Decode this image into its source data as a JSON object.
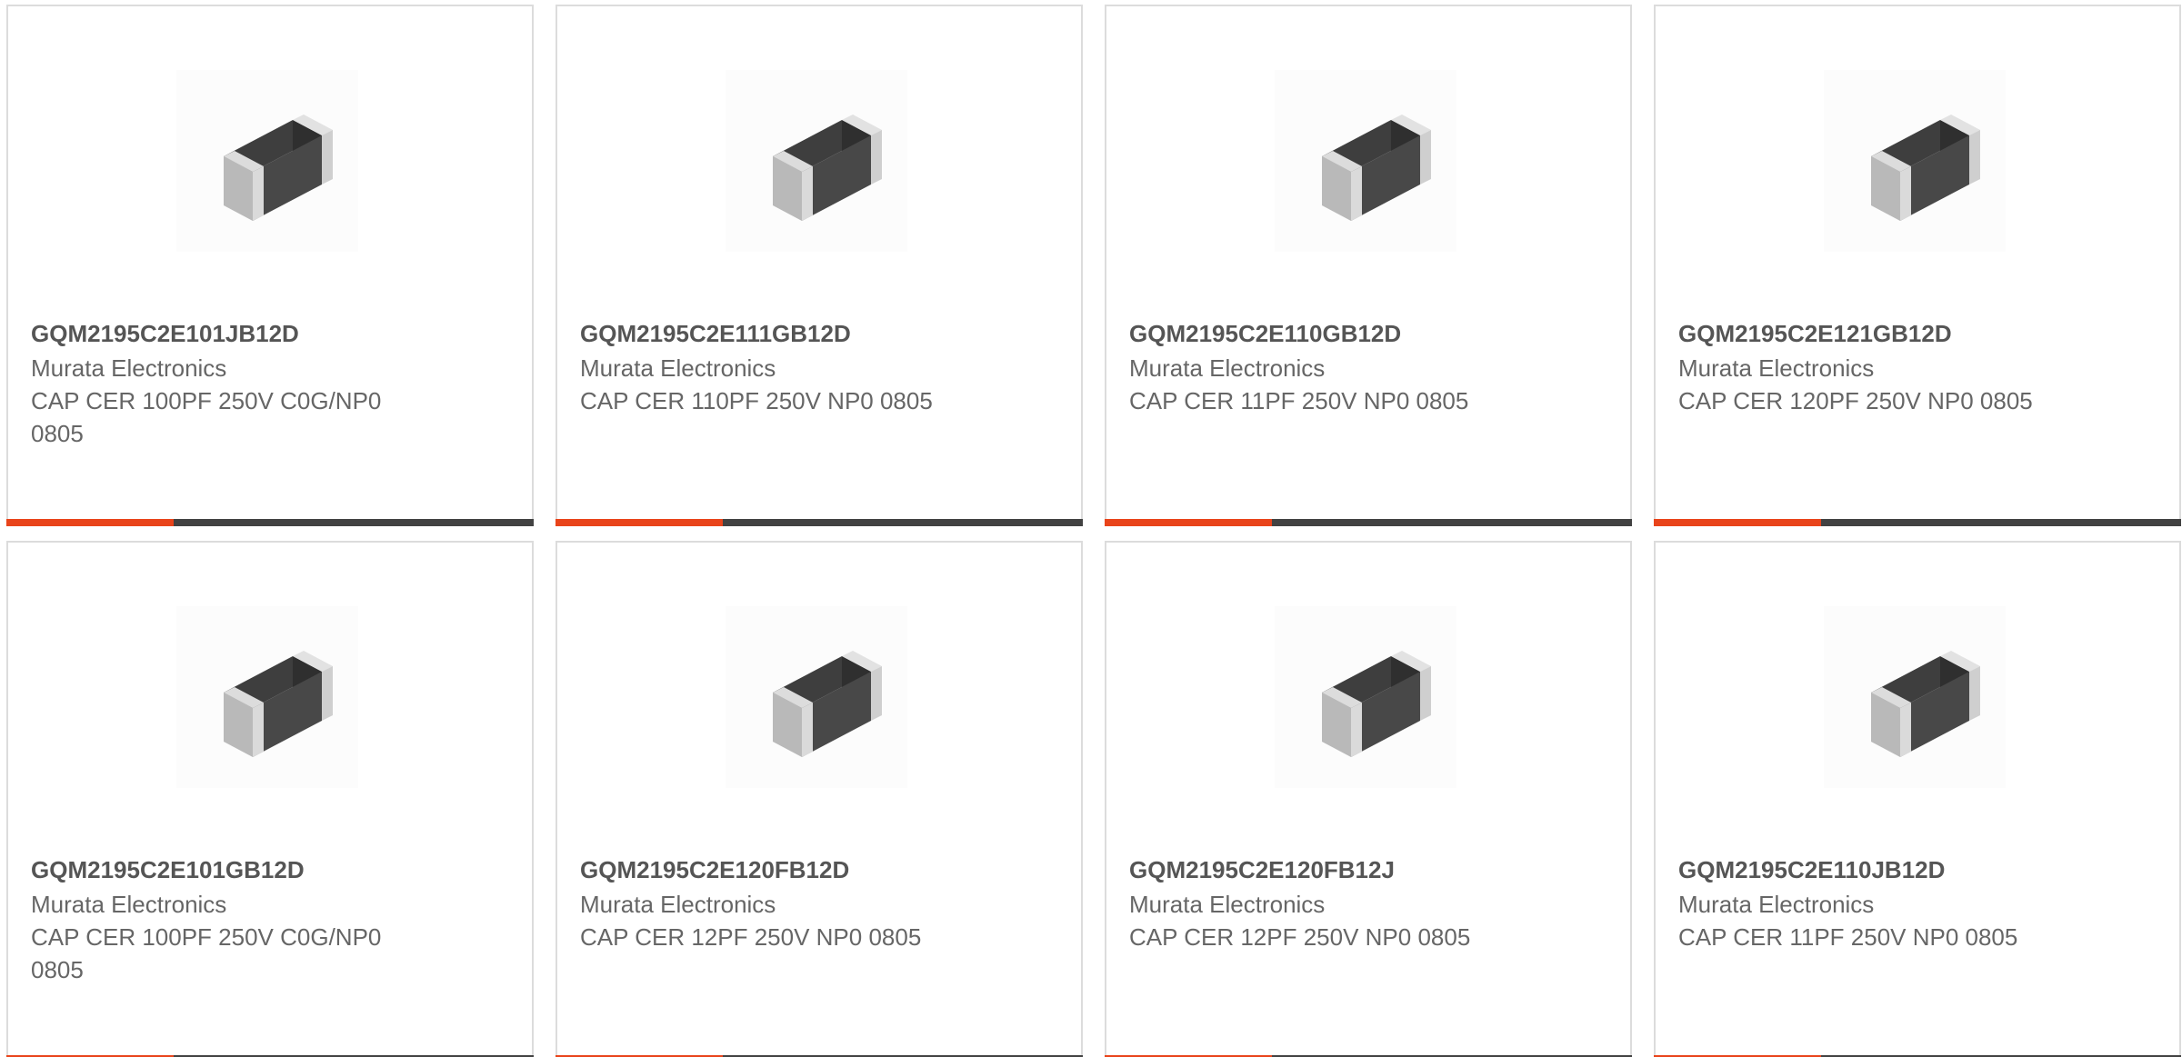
{
  "colors": {
    "accent": "#e9441b",
    "bar_dark": "#424242",
    "part_text": "#555555",
    "body_text": "#666666",
    "border": "#dcdcdc"
  },
  "products": [
    {
      "part_number": "GQM2195C2E101JB12D",
      "manufacturer": "Murata Electronics",
      "description": "CAP CER 100PF 250V C0G/NP0 0805",
      "image": "ceramic-chip-capacitor-icon"
    },
    {
      "part_number": "GQM2195C2E111GB12D",
      "manufacturer": "Murata Electronics",
      "description": "CAP CER 110PF 250V NP0 0805",
      "image": "ceramic-chip-capacitor-icon"
    },
    {
      "part_number": "GQM2195C2E110GB12D",
      "manufacturer": "Murata Electronics",
      "description": "CAP CER 11PF 250V NP0 0805",
      "image": "ceramic-chip-capacitor-icon"
    },
    {
      "part_number": "GQM2195C2E121GB12D",
      "manufacturer": "Murata Electronics",
      "description": "CAP CER 120PF 250V NP0 0805",
      "image": "ceramic-chip-capacitor-icon"
    },
    {
      "part_number": "GQM2195C2E101GB12D",
      "manufacturer": "Murata Electronics",
      "description": "CAP CER 100PF 250V C0G/NP0 0805",
      "image": "ceramic-chip-capacitor-icon"
    },
    {
      "part_number": "GQM2195C2E120FB12D",
      "manufacturer": "Murata Electronics",
      "description": "CAP CER 12PF 250V NP0 0805",
      "image": "ceramic-chip-capacitor-icon"
    },
    {
      "part_number": "GQM2195C2E120FB12J",
      "manufacturer": "Murata Electronics",
      "description": "CAP CER 12PF 250V NP0 0805",
      "image": "ceramic-chip-capacitor-icon"
    },
    {
      "part_number": "GQM2195C2E110JB12D",
      "manufacturer": "Murata Electronics",
      "description": "CAP CER 11PF 250V NP0 0805",
      "image": "ceramic-chip-capacitor-icon"
    }
  ]
}
